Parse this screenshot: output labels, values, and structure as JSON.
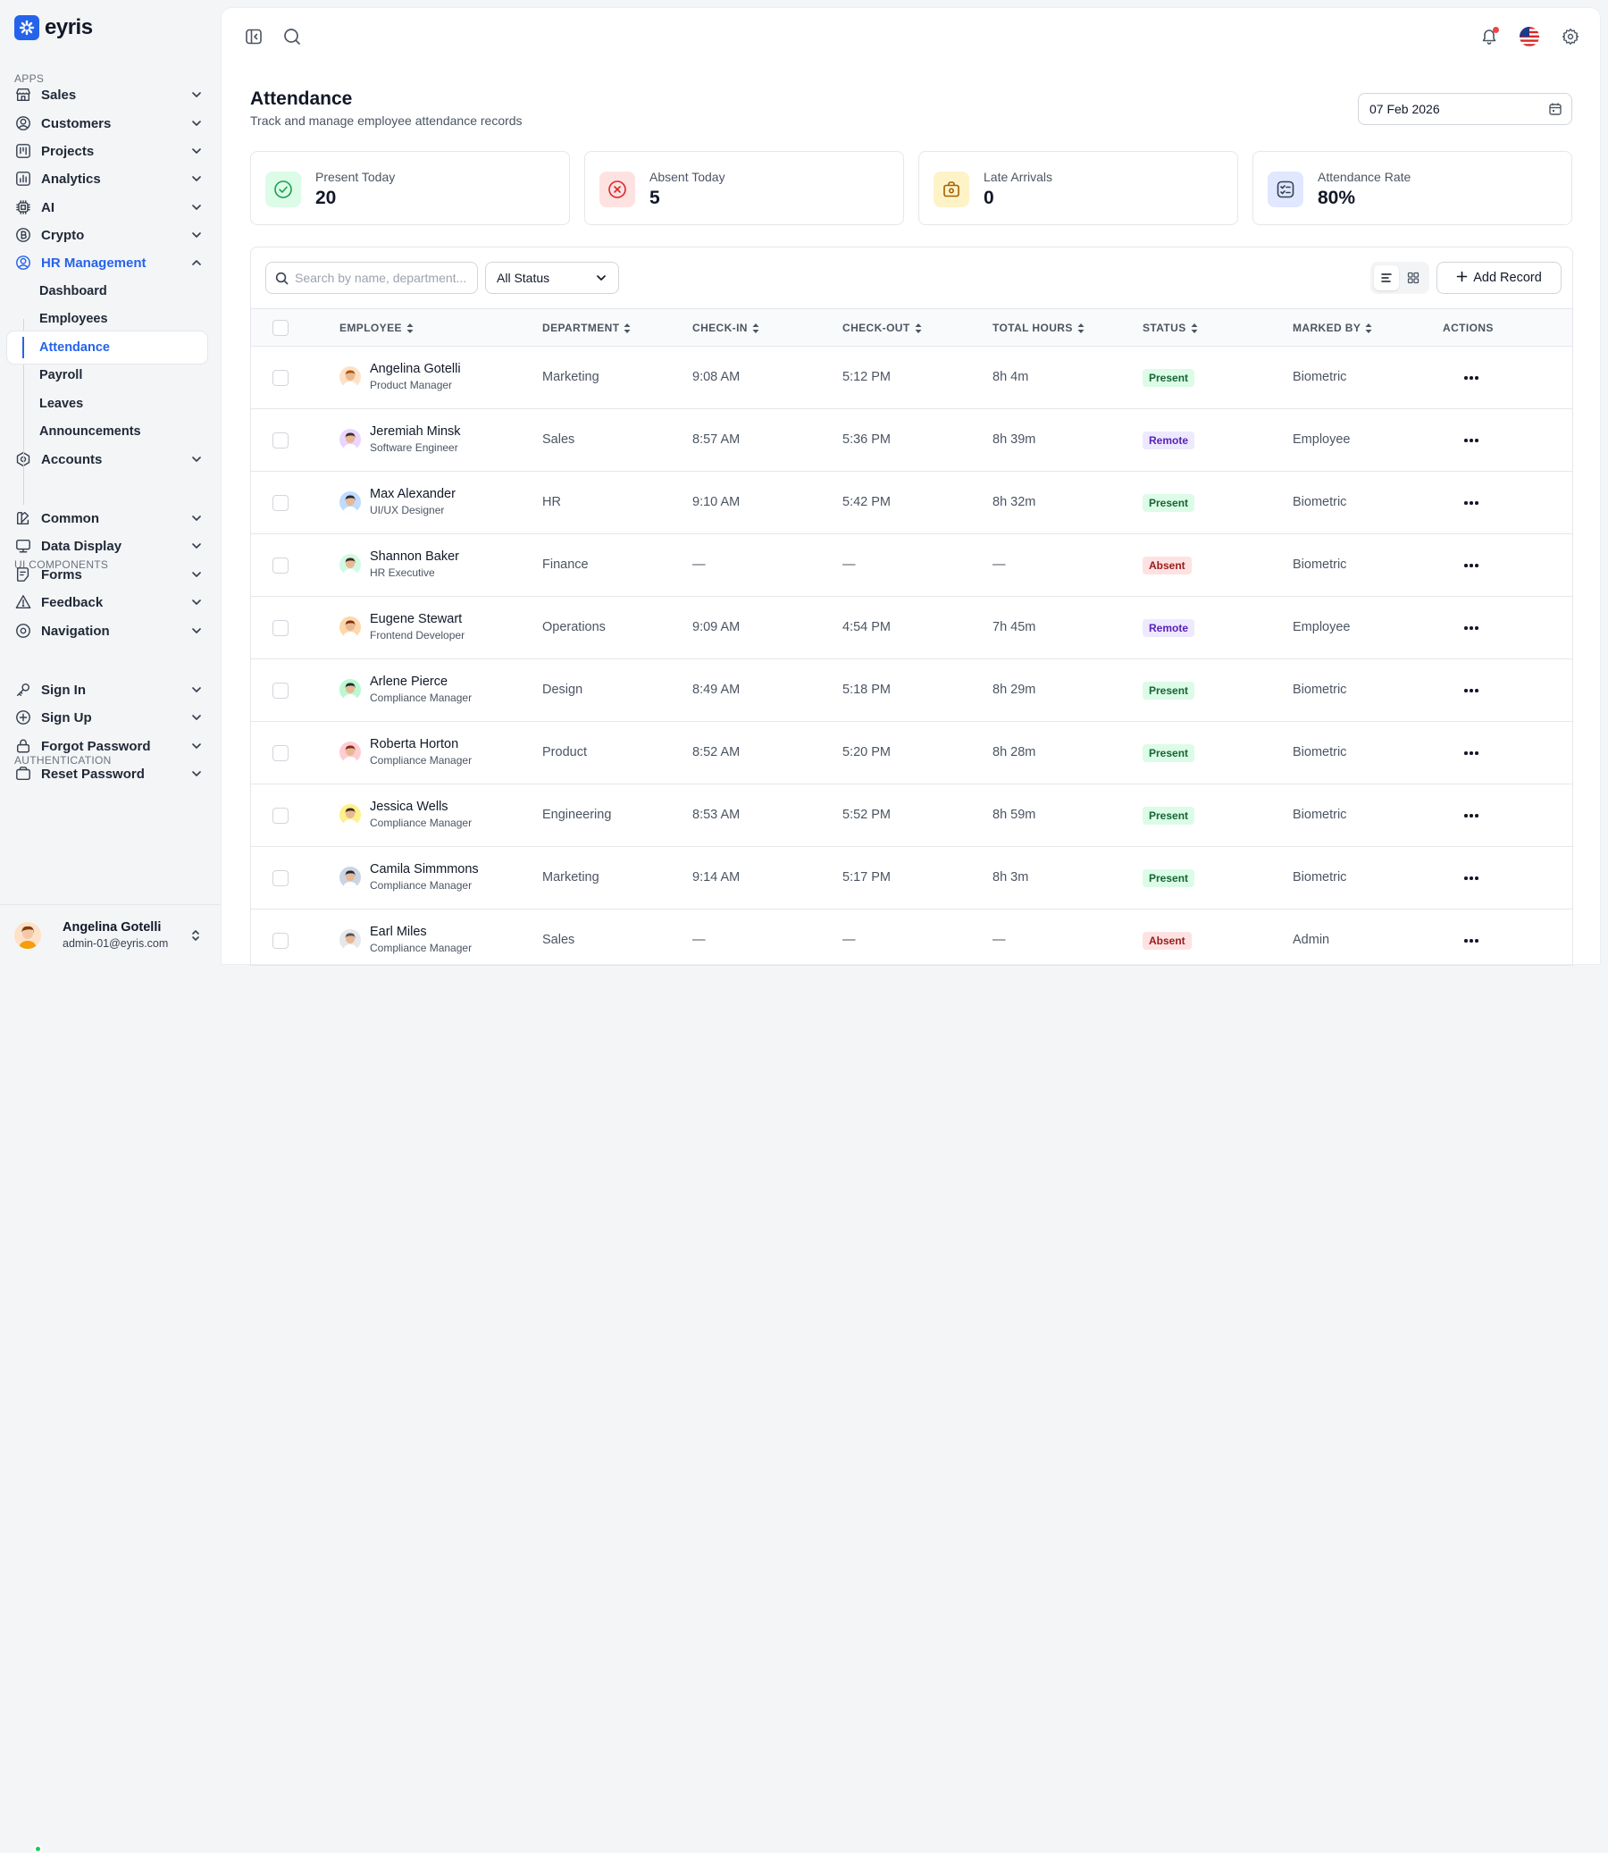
{
  "app": {
    "name": "eyris"
  },
  "sidebar": {
    "sections": {
      "apps": "APPS",
      "ui": "UI COMPONENTS",
      "auth": "AUTHENTICATION"
    },
    "apps": [
      {
        "label": "Sales",
        "icon": "store-icon"
      },
      {
        "label": "Customers",
        "icon": "user-circle-icon"
      },
      {
        "label": "Projects",
        "icon": "kanban-icon"
      },
      {
        "label": "Analytics",
        "icon": "bar-chart-icon"
      },
      {
        "label": "AI",
        "icon": "chip-icon"
      },
      {
        "label": "Crypto",
        "icon": "bitcoin-icon"
      },
      {
        "label": "HR Management",
        "icon": "user-circle-icon"
      },
      {
        "label": "Accounts",
        "icon": "hexagon-icon"
      }
    ],
    "hr_sub": [
      "Dashboard",
      "Employees",
      "Attendance",
      "Payroll",
      "Leaves",
      "Announcements"
    ],
    "ui": [
      {
        "label": "Common",
        "icon": "brush-icon"
      },
      {
        "label": "Data Display",
        "icon": "monitor-icon"
      },
      {
        "label": "Forms",
        "icon": "form-icon"
      },
      {
        "label": "Feedback",
        "icon": "alert-triangle-icon"
      },
      {
        "label": "Navigation",
        "icon": "map-pin-icon"
      }
    ],
    "auth": [
      {
        "label": "Sign In",
        "icon": "key-icon"
      },
      {
        "label": "Sign Up",
        "icon": "plus-circle-icon"
      },
      {
        "label": "Forgot Password",
        "icon": "lock-icon"
      },
      {
        "label": "Reset Password",
        "icon": "refresh-icon"
      }
    ],
    "user": {
      "name": "Angelina Gotelli",
      "email": "admin-01@eyris.com"
    }
  },
  "header": {
    "title": "Attendance",
    "subtitle": "Track and manage employee attendance records",
    "date": "07 Feb 2026"
  },
  "stats": [
    {
      "label": "Present Today",
      "value": "20",
      "color": "#16a34a",
      "bg": "#dcfce7",
      "icon": "check-circle-icon"
    },
    {
      "label": "Absent Today",
      "value": "5",
      "color": "#dc2626",
      "bg": "#fee2e2",
      "icon": "x-circle-icon"
    },
    {
      "label": "Late Arrivals",
      "value": "0",
      "color": "#a16207",
      "bg": "#fef3c7",
      "icon": "briefcase-icon"
    },
    {
      "label": "Attendance Rate",
      "value": "80%",
      "color": "#334155",
      "bg": "#e0e7ff",
      "icon": "checklist-icon"
    }
  ],
  "toolbar": {
    "search_placeholder": "Search by name, department...",
    "status_filter": "All Status",
    "add_label": "Add Record"
  },
  "table": {
    "columns": [
      "EMPLOYEE",
      "DEPARTMENT",
      "CHECK-IN",
      "CHECK-OUT",
      "TOTAL HOURS",
      "STATUS",
      "MARKED BY",
      "ACTIONS"
    ],
    "rows": [
      {
        "name": "Angelina Gotelli",
        "role": "Product Manager",
        "dept": "Marketing",
        "in": "9:08 AM",
        "out": "5:12 PM",
        "hours": "8h 4m",
        "status": "Present",
        "by": "Biometric",
        "avatar_bg": "#fde2c8",
        "avatar_fg": "#b45309"
      },
      {
        "name": "Jeremiah Minsk",
        "role": "Software Engineer",
        "dept": "Sales",
        "in": "8:57 AM",
        "out": "5:36 PM",
        "hours": "8h 39m",
        "status": "Remote",
        "by": "Employee",
        "avatar_bg": "#e9d5ff",
        "avatar_fg": "#3f2a1d"
      },
      {
        "name": "Max Alexander",
        "role": "UI/UX Designer",
        "dept": "HR",
        "in": "9:10 AM",
        "out": "5:42 PM",
        "hours": "8h 32m",
        "status": "Present",
        "by": "Biometric",
        "avatar_bg": "#bfdbfe",
        "avatar_fg": "#1f2937"
      },
      {
        "name": "Shannon Baker",
        "role": "HR Executive",
        "dept": "Finance",
        "in": "—",
        "out": "—",
        "hours": "—",
        "status": "Absent",
        "by": "Biometric",
        "avatar_bg": "#d1fae5",
        "avatar_fg": "#3f2a1d"
      },
      {
        "name": "Eugene Stewart",
        "role": "Frontend Developer",
        "dept": "Operations",
        "in": "9:09 AM",
        "out": "4:54 PM",
        "hours": "7h 45m",
        "status": "Remote",
        "by": "Employee",
        "avatar_bg": "#fed7aa",
        "avatar_fg": "#7c2d12"
      },
      {
        "name": "Arlene Pierce",
        "role": "Compliance Manager",
        "dept": "Design",
        "in": "8:49 AM",
        "out": "5:18 PM",
        "hours": "8h 29m",
        "status": "Present",
        "by": "Biometric",
        "avatar_bg": "#bbf7d0",
        "avatar_fg": "#1f2937"
      },
      {
        "name": "Roberta Horton",
        "role": "Compliance Manager",
        "dept": "Product",
        "in": "8:52 AM",
        "out": "5:20 PM",
        "hours": "8h 28m",
        "status": "Present",
        "by": "Biometric",
        "avatar_bg": "#fecdd3",
        "avatar_fg": "#7c2d12"
      },
      {
        "name": "Jessica Wells",
        "role": "Compliance Manager",
        "dept": "Engineering",
        "in": "8:53 AM",
        "out": "5:52 PM",
        "hours": "8h 59m",
        "status": "Present",
        "by": "Biometric",
        "avatar_bg": "#fef08a",
        "avatar_fg": "#3f2a1d"
      },
      {
        "name": "Camila Simmmons",
        "role": "Compliance Manager",
        "dept": "Marketing",
        "in": "9:14 AM",
        "out": "5:17 PM",
        "hours": "8h 3m",
        "status": "Present",
        "by": "Biometric",
        "avatar_bg": "#cbd5e1",
        "avatar_fg": "#1f2937"
      },
      {
        "name": "Earl Miles",
        "role": "Compliance Manager",
        "dept": "Sales",
        "in": "—",
        "out": "—",
        "hours": "—",
        "status": "Absent",
        "by": "Admin",
        "avatar_bg": "#e5e7eb",
        "avatar_fg": "#57534e"
      }
    ]
  }
}
